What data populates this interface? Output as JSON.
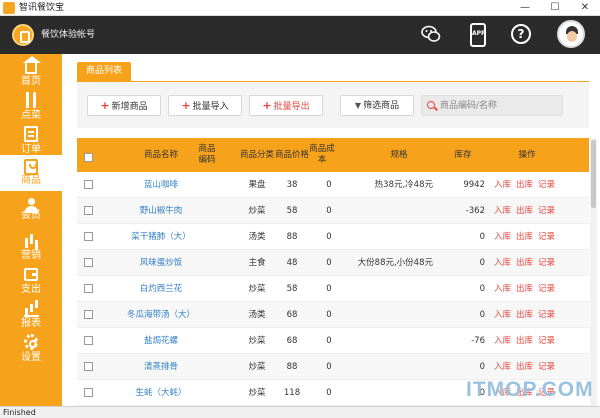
{
  "window": {
    "title": "智讯餐饮宝",
    "controls": {
      "minimize": "—",
      "maximize": "☐",
      "close": "✕"
    }
  },
  "header": {
    "account_name": "餐饮体验帐号",
    "app_badge": "APP",
    "help_glyph": "?",
    "icons": [
      "wechat-icon",
      "app-download-icon",
      "help-icon",
      "avatar"
    ]
  },
  "sidebar": {
    "items": [
      {
        "label": "首页",
        "icon": "home-icon"
      },
      {
        "label": "点菜",
        "icon": "fork-icon"
      },
      {
        "label": "订单",
        "icon": "order-icon"
      },
      {
        "label": "商品",
        "icon": "goods-icon",
        "active": true
      },
      {
        "label": "会员",
        "icon": "member-icon"
      },
      {
        "label": "营销",
        "icon": "marketing-icon"
      },
      {
        "label": "支出",
        "icon": "expense-icon"
      },
      {
        "label": "报表",
        "icon": "report-icon"
      },
      {
        "label": "设置",
        "icon": "settings-icon"
      }
    ]
  },
  "main": {
    "tab_label": "商品列表",
    "toolbar": {
      "add_label": "新增商品",
      "import_label": "批量导入",
      "export_label": "批量导出",
      "filter_label": "筛选商品",
      "search_placeholder": "商品编码/名称"
    },
    "table": {
      "headers": {
        "name": "商品名称",
        "code": "商品编码",
        "category": "商品分类",
        "price": "商品价格",
        "cost": "商品成本",
        "spec": "规格",
        "stock": "库存",
        "actions": "操作"
      },
      "action_labels": {
        "in": "入库",
        "out": "出库",
        "log": "记录"
      },
      "rows": [
        {
          "name": "蓝山咖啡",
          "code": "",
          "category": "果盘",
          "price": "38",
          "cost": "0",
          "spec": "热38元,冷48元",
          "stock": "9942"
        },
        {
          "name": "野山椒牛肉",
          "code": "",
          "category": "炒菜",
          "price": "58",
          "cost": "0",
          "spec": "",
          "stock": "-362"
        },
        {
          "name": "菜干猪肺（大）",
          "code": "",
          "category": "汤类",
          "price": "88",
          "cost": "0",
          "spec": "",
          "stock": "0"
        },
        {
          "name": "风味蛋炒饭",
          "code": "",
          "category": "主食",
          "price": "48",
          "cost": "0",
          "spec": "大份88元,小份48元",
          "stock": "0"
        },
        {
          "name": "白灼西兰花",
          "code": "",
          "category": "炒菜",
          "price": "58",
          "cost": "0",
          "spec": "",
          "stock": "0"
        },
        {
          "name": "冬瓜海带汤（大）",
          "code": "",
          "category": "汤类",
          "price": "68",
          "cost": "0",
          "spec": "",
          "stock": "0"
        },
        {
          "name": "盐焗花螺",
          "code": "",
          "category": "炒菜",
          "price": "68",
          "cost": "0",
          "spec": "",
          "stock": "-76"
        },
        {
          "name": "清蒸排骨",
          "code": "",
          "category": "炒菜",
          "price": "88",
          "cost": "0",
          "spec": "",
          "stock": "0"
        },
        {
          "name": "生蚝（大蚝）",
          "code": "",
          "category": "炒菜",
          "price": "118",
          "cost": "0",
          "spec": "",
          "stock": "0"
        }
      ]
    }
  },
  "status_bar": {
    "text": "Finished"
  },
  "watermark": "ITMOP.COM",
  "colors": {
    "accent": "#f7a21b",
    "header_bg": "#2b2b2b",
    "link_blue": "#2f7fc9",
    "action_red": "#e8453c"
  }
}
